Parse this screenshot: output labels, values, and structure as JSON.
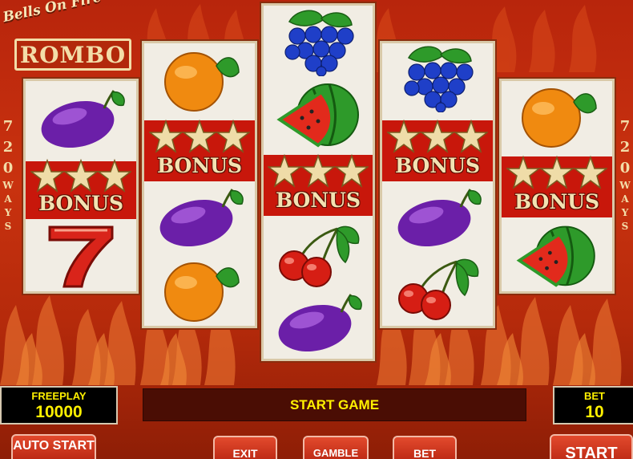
{
  "game": {
    "logo_top": "Bells On Fire",
    "logo_main": "ROMBO",
    "ways_number": [
      "7",
      "2",
      "0"
    ],
    "ways_word": [
      "W",
      "A",
      "Y",
      "S"
    ]
  },
  "symbols": {
    "bonus_label": "BONUS"
  },
  "reels": [
    [
      "plum-icon",
      "bonus-icon",
      "seven-icon"
    ],
    [
      "orange-icon",
      "bonus-icon",
      "plum-icon",
      "orange-icon"
    ],
    [
      "grapes-icon",
      "watermelon-icon",
      "bonus-icon",
      "cherries-icon",
      "plum-icon"
    ],
    [
      "grapes-icon",
      "bonus-icon",
      "plum-icon",
      "cherries-icon"
    ],
    [
      "orange-icon",
      "bonus-icon",
      "watermelon-icon"
    ]
  ],
  "status": {
    "freeplay_label": "FREEPLAY",
    "freeplay_value": "10000",
    "message": "START GAME",
    "bet_label": "BET",
    "bet_value": "10"
  },
  "buttons": {
    "auto_start": "AUTO START",
    "exit": "EXIT",
    "gamble": "GAMBLE",
    "bet": "BET",
    "start": "START"
  },
  "colors": {
    "background": "#c9320f",
    "panel_text": "#fff000",
    "bonus_band": "#c8170b"
  }
}
